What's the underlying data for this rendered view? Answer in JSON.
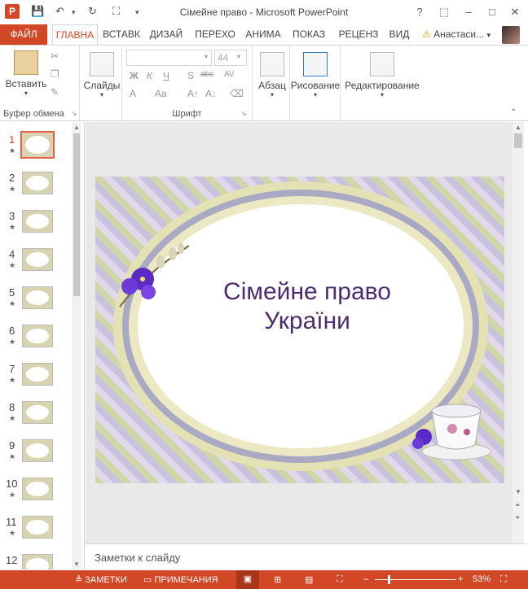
{
  "window": {
    "title": "Сімейне право - Microsoft PowerPoint",
    "help": "?",
    "minimize": "–",
    "restore": "□",
    "close": "✕"
  },
  "qat": {
    "save": "💾",
    "undo": "↶",
    "redo": "↻",
    "present": "⛶",
    "more": "▾"
  },
  "tabs": {
    "file": "ФАЙЛ",
    "home": "ГЛАВНА",
    "insert": "ВСТАВК",
    "design": "ДИЗАЙ",
    "transitions": "ПЕРЕХО",
    "animations": "АНИМА",
    "slideshow": "ПОКАЗ",
    "review": "РЕЦЕНЗ",
    "view": "ВИД"
  },
  "user": {
    "name": "Анастаси...",
    "warning": "⚠"
  },
  "ribbon": {
    "clipboard": {
      "paste": "Вставить",
      "label": "Буфер обмена"
    },
    "slides": {
      "label": "Слайды"
    },
    "font": {
      "size": "44",
      "label": "Шрифт",
      "bold": "Ж",
      "italic": "К",
      "underline": "Ч",
      "strike": "S",
      "shadow": "abc",
      "spacing": "AV",
      "case": "Aa",
      "color": "A"
    },
    "paragraph": {
      "label": "Абзац"
    },
    "drawing": {
      "label": "Рисование"
    },
    "editing": {
      "label": "Редактирование"
    }
  },
  "thumbnails": [
    "1",
    "2",
    "3",
    "4",
    "5",
    "6",
    "7",
    "8",
    "9",
    "10",
    "11",
    "12"
  ],
  "slide": {
    "title_line1": "Сімейне право",
    "title_line2": "України"
  },
  "notes": {
    "placeholder": "Заметки к слайду"
  },
  "status": {
    "notes": "ЗАМЕТКИ",
    "comments": "ПРИМЕЧАНИЯ",
    "zoom": "53%"
  },
  "colors": {
    "accent": "#d24726",
    "title_text": "#4b2d6e"
  }
}
